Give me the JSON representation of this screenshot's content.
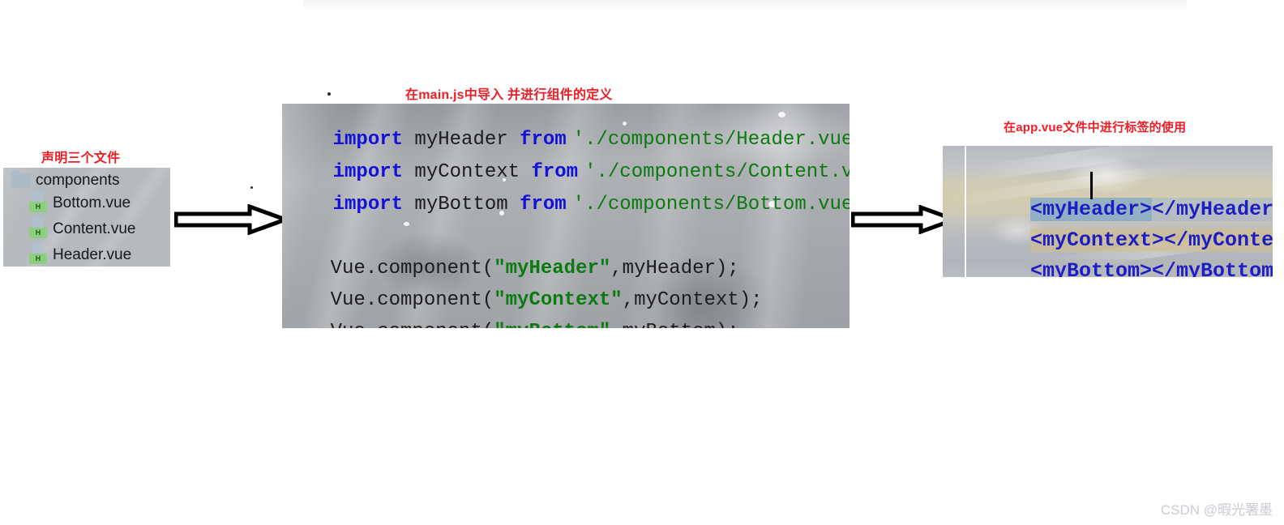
{
  "captions": {
    "left": "声明三个文件",
    "center": "在main.js中导入 并进行组件的定义",
    "right": "在app.vue文件中进行标签的使用"
  },
  "colors": {
    "caption_red": "#ee1c25",
    "keyword_blue": "#1111d8",
    "string_green": "#0b7a10",
    "tag_blue": "#1d1dc4",
    "panel_gray": "#b6b9bd",
    "file_badge_green": "#8ccf7e"
  },
  "file_tree": {
    "root": {
      "icon": "folder-icon",
      "label": "components"
    },
    "files": [
      {
        "icon": "vue-file-icon",
        "badge": "H",
        "label": "Bottom.vue"
      },
      {
        "icon": "vue-file-icon",
        "badge": "H",
        "label": "Content.vue"
      },
      {
        "icon": "vue-file-icon",
        "badge": "H",
        "label": "Header.vue"
      }
    ]
  },
  "code_block": {
    "imports": [
      {
        "keyword": "import",
        "name": " myHeader ",
        "from": "from",
        "path": "'./components/Header.vue'"
      },
      {
        "keyword": "import",
        "name": " myContext ",
        "from": "from",
        "path": "'./components/Content.vue'"
      },
      {
        "keyword": "import",
        "name": " myBottom ",
        "from": "from",
        "path": "'./components/Bottom.vue'"
      }
    ],
    "registrations": [
      {
        "prefix": "Vue.component(",
        "quote_open": "\"",
        "tag": "myHeader",
        "quote_close": "\"",
        "suffix": ",myHeader);"
      },
      {
        "prefix": "Vue.component(",
        "quote_open": "\"",
        "tag": "myContext",
        "quote_close": "\"",
        "suffix": ",myContext);"
      },
      {
        "prefix": "Vue.component(",
        "quote_open": "\"",
        "tag": "myBottom",
        "quote_close": "\"",
        "suffix": ",myBottom);"
      }
    ]
  },
  "app_vue": {
    "tags": [
      {
        "open": "<myHeader>",
        "close": "</myHeader>"
      },
      {
        "open": "<myContext>",
        "close": "</myContext>"
      },
      {
        "open": "<myBottom>",
        "close": "</myBottom>"
      }
    ]
  },
  "arrows": {
    "left_to_center": "arrow-right-icon",
    "center_to_right": "arrow-right-icon"
  },
  "watermark": "CSDN @暇光署墨"
}
